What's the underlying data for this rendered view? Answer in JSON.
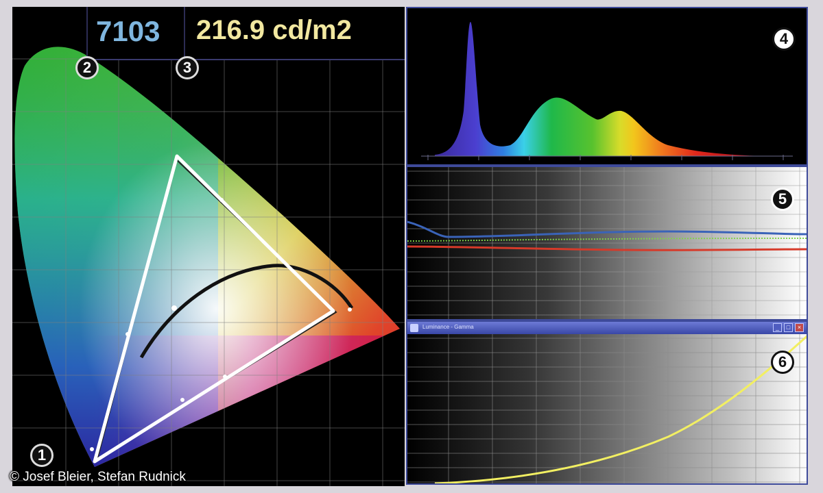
{
  "readout": {
    "color_temperature": "7103",
    "luminance": "216.9 cd/m2"
  },
  "badges": {
    "chromaticity": "1",
    "color_temperature": "2",
    "luminance": "3",
    "spectrum": "4",
    "rgb_balance": "5",
    "gamma": "6"
  },
  "gamma_window": {
    "title": "Luminance - Gamma"
  },
  "copyright": "© Josef Bleier, Stefan Rudnick",
  "colors": {
    "cct_text": "#7fb6df",
    "luminance_text": "#f2e8a0",
    "panel_border": "#3e4a9a",
    "red_channel": "#d63a2a",
    "green_channel": "#7fd24a",
    "blue_channel": "#3a63b8",
    "gamma_curve": "#f2ef62",
    "gamut_triangle": "#ffffff"
  }
}
